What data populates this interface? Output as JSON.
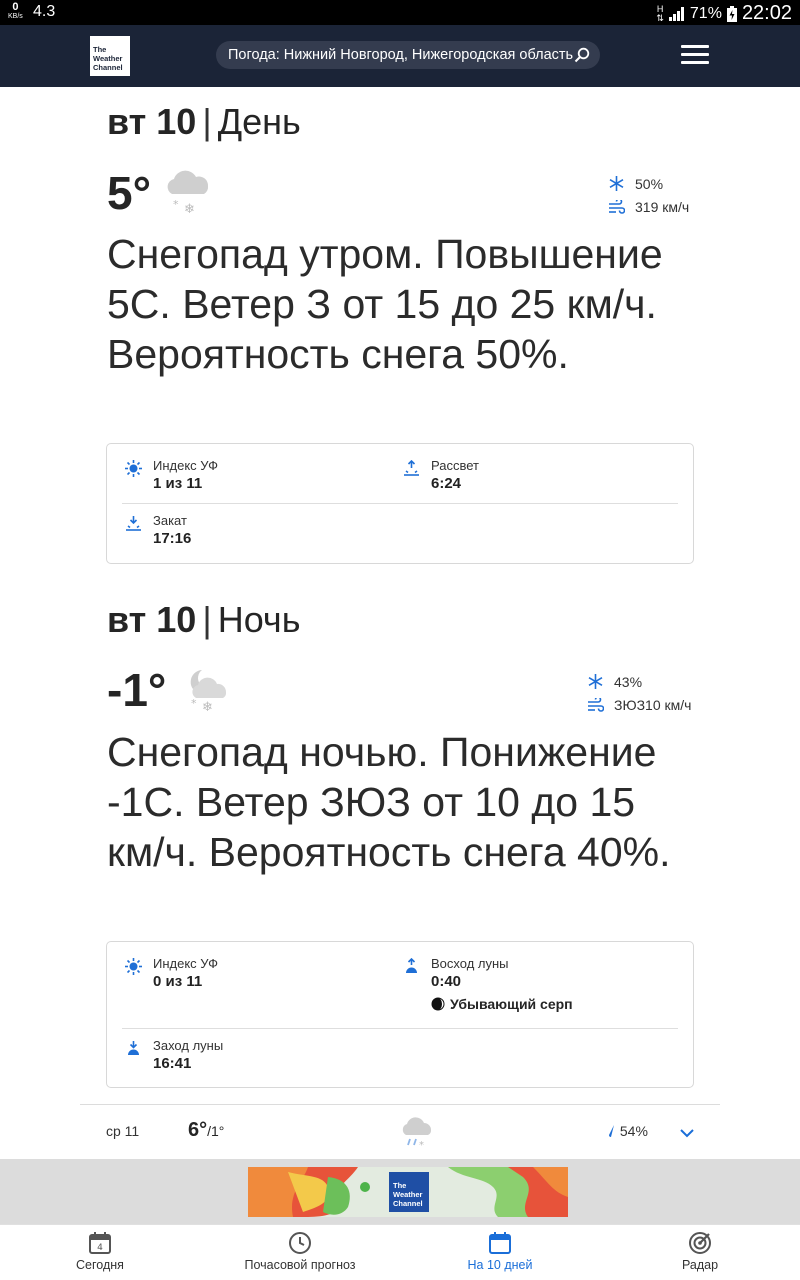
{
  "status_bar": {
    "speed_value": "0",
    "speed_unit": "KB/s",
    "left_number": "4.3",
    "network": "H",
    "battery": "71%",
    "time": "22:02"
  },
  "header": {
    "logo_text": "The Weather Channel",
    "search_text": "Погода: Нижний Новгород, Нижегородская область"
  },
  "day_period": {
    "day_label": "вт 10",
    "part": "День",
    "temperature": "5°",
    "precip_chance": "50%",
    "wind": "319 км/ч",
    "narrative": "Снегопад утром. Повышение 5С. Ветер З от 15 до 25 км/ч. Вероятность снега 50%.",
    "uv_label": "Индекс УФ",
    "uv_value": "1 из 11",
    "sunrise_label": "Рассвет",
    "sunrise_value": "6:24",
    "sunset_label": "Закат",
    "sunset_value": "17:16"
  },
  "night_period": {
    "day_label": "вт 10",
    "part": "Ночь",
    "temperature": "-1°",
    "precip_chance": "43%",
    "wind": "ЗЮЗ10 км/ч",
    "narrative": "Снегопад ночью. Понижение -1С. Ветер ЗЮЗ от 10 до 15 км/ч. Вероятность снега 40%.",
    "uv_label": "Индекс УФ",
    "uv_value": "0 из 11",
    "moonrise_label": "Восход луны",
    "moonrise_value": "0:40",
    "moon_phase": "Убывающий серп",
    "moonset_label": "Заход луны",
    "moonset_value": "16:41"
  },
  "next_day": {
    "day_label": "ср 11",
    "high": "6°",
    "low": "/1°",
    "precip_chance": "54%"
  },
  "ad": {
    "logo_text": "The Weather Channel"
  },
  "bottom_nav": {
    "today_day_number": "4",
    "items": [
      {
        "label": "Сегодня"
      },
      {
        "label": "Почасовой прогноз"
      },
      {
        "label": "На 10 дней"
      },
      {
        "label": "Радар"
      }
    ]
  },
  "colors": {
    "header_bg": "#1b2437",
    "accent_blue": "#1a6ed8",
    "icon_blue": "#1f6fd6"
  }
}
